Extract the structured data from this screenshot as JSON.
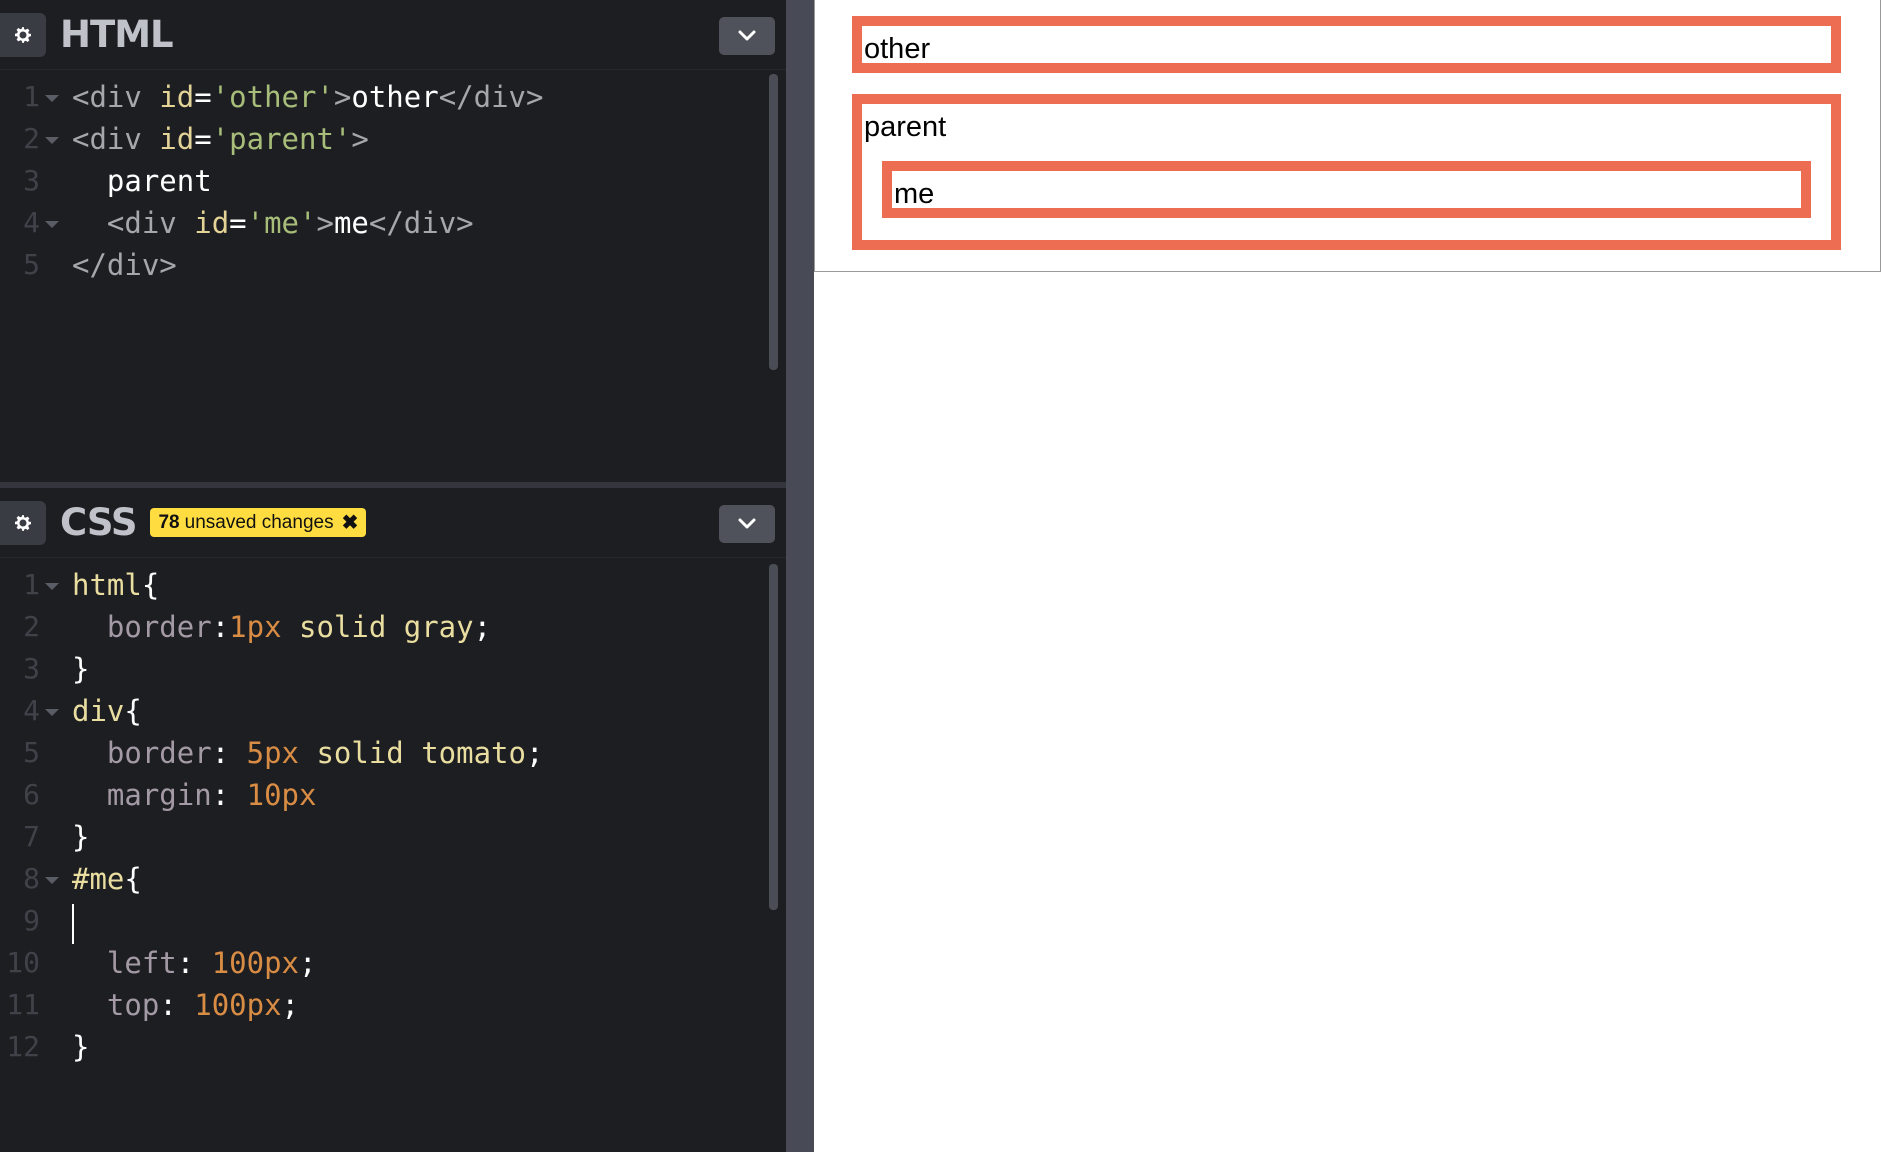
{
  "html_editor": {
    "title": "HTML",
    "lines": [
      "1",
      "2",
      "3",
      "4",
      "5"
    ]
  },
  "css_editor": {
    "title": "CSS",
    "unsaved_count": "78",
    "unsaved_text": "unsaved changes",
    "unsaved_close": "✖",
    "lines": [
      "1",
      "2",
      "3",
      "4",
      "5",
      "6",
      "7",
      "8",
      "9",
      "10",
      "11",
      "12"
    ]
  },
  "html_code": {
    "l1": {
      "open": "<div ",
      "attr": "id",
      "eq": "=",
      "val": "'other'",
      "close": ">",
      "text": "other",
      "end": "</div>"
    },
    "l2": {
      "open": "<div ",
      "attr": "id",
      "eq": "=",
      "val": "'parent'",
      "close": ">"
    },
    "l3": {
      "text": "parent"
    },
    "l4": {
      "open": "<div ",
      "attr": "id",
      "eq": "=",
      "val": "'me'",
      "close": ">",
      "text": "me",
      "end": "</div>"
    },
    "l5": {
      "end": "</div>"
    }
  },
  "css_code": {
    "l1": {
      "sel": "html",
      "brace": "{"
    },
    "l2": {
      "prop": "border",
      "colon": ":",
      "num": "1px",
      "rest": " solid gray",
      "semi": ";"
    },
    "l3": {
      "brace": "}"
    },
    "l4": {
      "sel": "div",
      "brace": "{"
    },
    "l5": {
      "prop": "border",
      "colon": ": ",
      "num": "5px",
      "rest": " solid tomato",
      "semi": ";"
    },
    "l6": {
      "prop": "margin",
      "colon": ": ",
      "num": "10px"
    },
    "l7": {
      "brace": "}"
    },
    "l8": {
      "sel": "#me",
      "brace": "{"
    },
    "l10": {
      "prop": "left",
      "colon": ": ",
      "num": "100px",
      "semi": ";"
    },
    "l11": {
      "prop": "top",
      "colon": ": ",
      "num": "100px",
      "semi": ";"
    },
    "l12": {
      "brace": "}"
    }
  },
  "preview": {
    "other": "other",
    "parent": "parent",
    "me": "me"
  },
  "colors": {
    "editor_bg": "#1d1e22",
    "tomato_border": "#ed6d53",
    "badge": "#ffdd40"
  },
  "icons": {
    "settings": "gear-icon",
    "collapse": "chevron-down-icon",
    "close": "close-icon"
  }
}
